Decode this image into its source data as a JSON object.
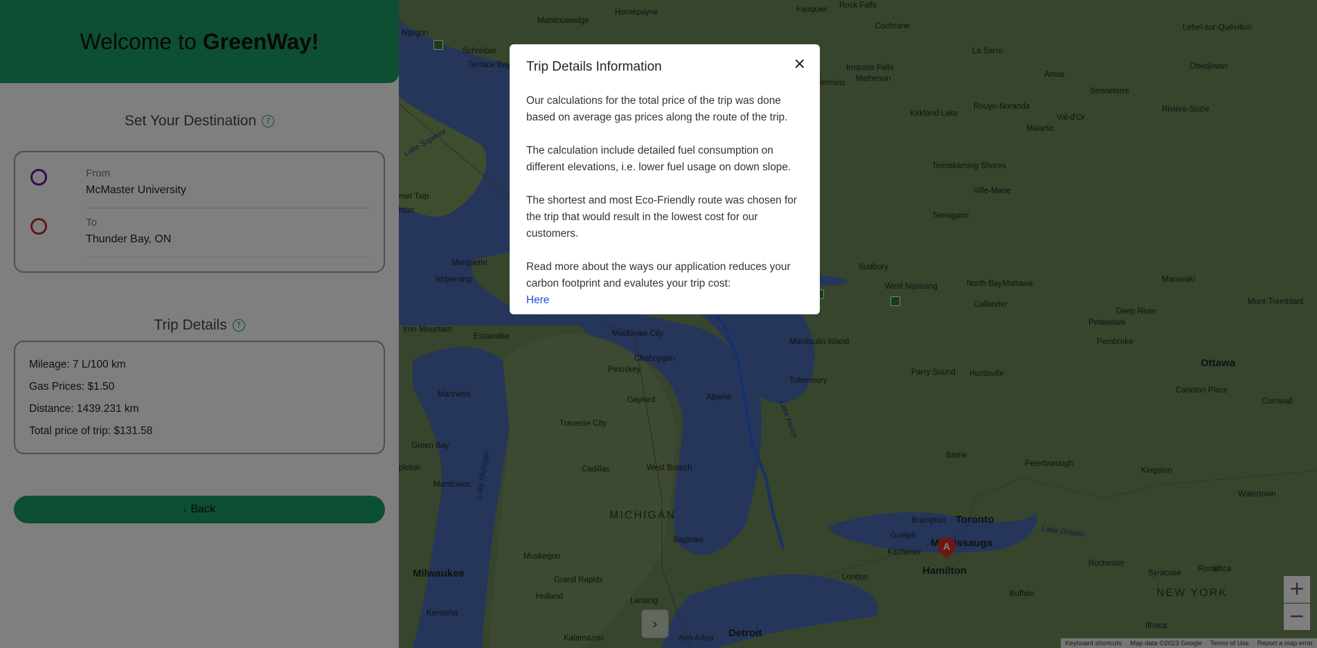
{
  "header": {
    "welcome": "Welcome to",
    "brand": "GreenWay!"
  },
  "destination": {
    "title": "Set Your Destination",
    "help_icon": "?",
    "from_label": "From",
    "from_value": "McMaster University",
    "to_label": "To",
    "to_value": "Thunder Bay, ON"
  },
  "trip": {
    "title": "Trip Details",
    "help_icon": "?",
    "mileage": "Mileage: 7 L/100 km",
    "gas": "Gas Prices: $1.50",
    "distance": "Distance: 1439.231 km",
    "total": "Total price of trip: $131.58"
  },
  "back_button": {
    "icon": "‹",
    "label": "Back"
  },
  "map": {
    "labels": [
      "Manitouwadge",
      "Hornepayne",
      "Fauquier",
      "Rock Falls",
      "Cochrane",
      "Lebel-sur-Quévillon",
      "Nipigon",
      "Schreiber",
      "Terrace Bay",
      "Iroquois Falls",
      "Matheson",
      "Timmins",
      "La Sarre",
      "Amos",
      "Obedjiwan",
      "Senneterre",
      "Kirkland Lake",
      "Rouyn-Noranda",
      "Val-d'Or",
      "Malartic",
      "Rivière-Suzie",
      "Temiskaming Shores",
      "Ville-Marie",
      "Temagami",
      "Sudbury",
      "West Nipissing",
      "North Bay",
      "Mattawa",
      "Callander",
      "Maniwaki",
      "Mont-Tremblant",
      "Deep River",
      "Petawawa",
      "Pembroke",
      "Ottawa",
      "Carleton Place",
      "Cornwall",
      "Marquette",
      "Ishpeming",
      "Iron Mountain",
      "Escanaba",
      "Mackinaw City",
      "Cheboygan",
      "Petoskey",
      "Gaylord",
      "Alpena",
      "Manitoulin Island",
      "Tobermory",
      "Parry Sound",
      "Huntsville",
      "Marinette",
      "Traverse City",
      "Green Bay",
      "Manitowoc",
      "Cadillac",
      "West Branch",
      "Barrie",
      "Peterborough",
      "Kingston",
      "Watertown",
      "MICHIGAN",
      "Saginaw",
      "Brampton",
      "Toronto",
      "Guelph",
      "Mississauga",
      "Kitchener",
      "Hamilton",
      "London",
      "Rochester",
      "Syracuse",
      "Utica",
      "Rome",
      "NEW YORK",
      "Milwaukee",
      "Muskegon",
      "Grand Rapids",
      "Holland",
      "Lansing",
      "Kenosha",
      "Detroit",
      "Ann Arbor",
      "Kalamazoo",
      "Buffalo",
      "Ithaca",
      "met Twp",
      "hton",
      "pleton"
    ],
    "water_labels": [
      "Lake Superior",
      "Lake Huron",
      "Lake Michigan",
      "Lake Ontario"
    ],
    "marker": "A",
    "zoom_in": "+",
    "zoom_out": "−",
    "collapse_icon": "›",
    "footer": [
      "Keyboard shortcuts",
      "Map data ©2023 Google",
      "Terms of Use",
      "Report a map error"
    ]
  },
  "modal": {
    "title": "Trip Details Information",
    "close_icon": "×",
    "p1": "Our calculations for the total price of the trip was done based on average gas prices along the route of the trip.",
    "p2": "The calculation include detailed fuel consumption on different elevations, i.e. lower fuel usage on down slope.",
    "p3": "The shortest and most Eco-Friendly route was chosen for the trip that would result in the lowest cost for our customers.",
    "p4": "Read more about the ways our application reduces your carbon footprint and evalutes your trip cost:",
    "link": "Here"
  },
  "colors": {
    "brand_green": "#1a9e67",
    "from_ring": "#6a0dad",
    "to_ring": "#c62828",
    "link": "#1d4ed8"
  }
}
